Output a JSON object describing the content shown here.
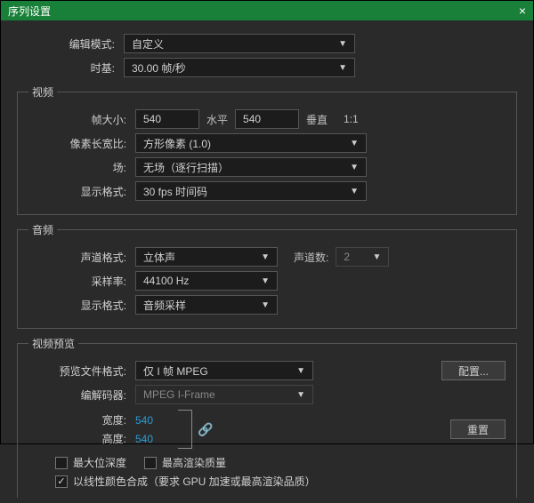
{
  "titlebar": {
    "title": "序列设置"
  },
  "top": {
    "edit_mode_label": "编辑模式:",
    "edit_mode_value": "自定义",
    "timebase_label": "时基:",
    "timebase_value": "30.00 帧/秒"
  },
  "video": {
    "legend": "视频",
    "frame_size_label": "帧大小:",
    "frame_w": "540",
    "frame_h": "540",
    "horiz": "水平",
    "vert": "垂直",
    "ratio": "1:1",
    "par_label": "像素长宽比:",
    "par_value": "方形像素 (1.0)",
    "fields_label": "场:",
    "fields_value": "无场（逐行扫描）",
    "display_fmt_label": "显示格式:",
    "display_fmt_value": "30 fps 时间码"
  },
  "audio": {
    "legend": "音频",
    "ch_fmt_label": "声道格式:",
    "ch_fmt_value": "立体声",
    "ch_count_label": "声道数:",
    "ch_count_value": "2",
    "sample_rate_label": "采样率:",
    "sample_rate_value": "44100 Hz",
    "display_fmt_label": "显示格式:",
    "display_fmt_value": "音频采样"
  },
  "preview": {
    "legend": "视频预览",
    "file_fmt_label": "预览文件格式:",
    "file_fmt_value": "仅 I 帧 MPEG",
    "codec_label": "编解码器:",
    "codec_value": "MPEG I-Frame",
    "width_label": "宽度:",
    "width_value": "540",
    "height_label": "高度:",
    "height_value": "540",
    "configure": "配置...",
    "reset": "重置",
    "max_bit_depth": "最大位深度",
    "max_render_quality": "最高渲染质量",
    "linear_color": "以线性颜色合成（要求 GPU 加速或最高渲染品质）"
  }
}
